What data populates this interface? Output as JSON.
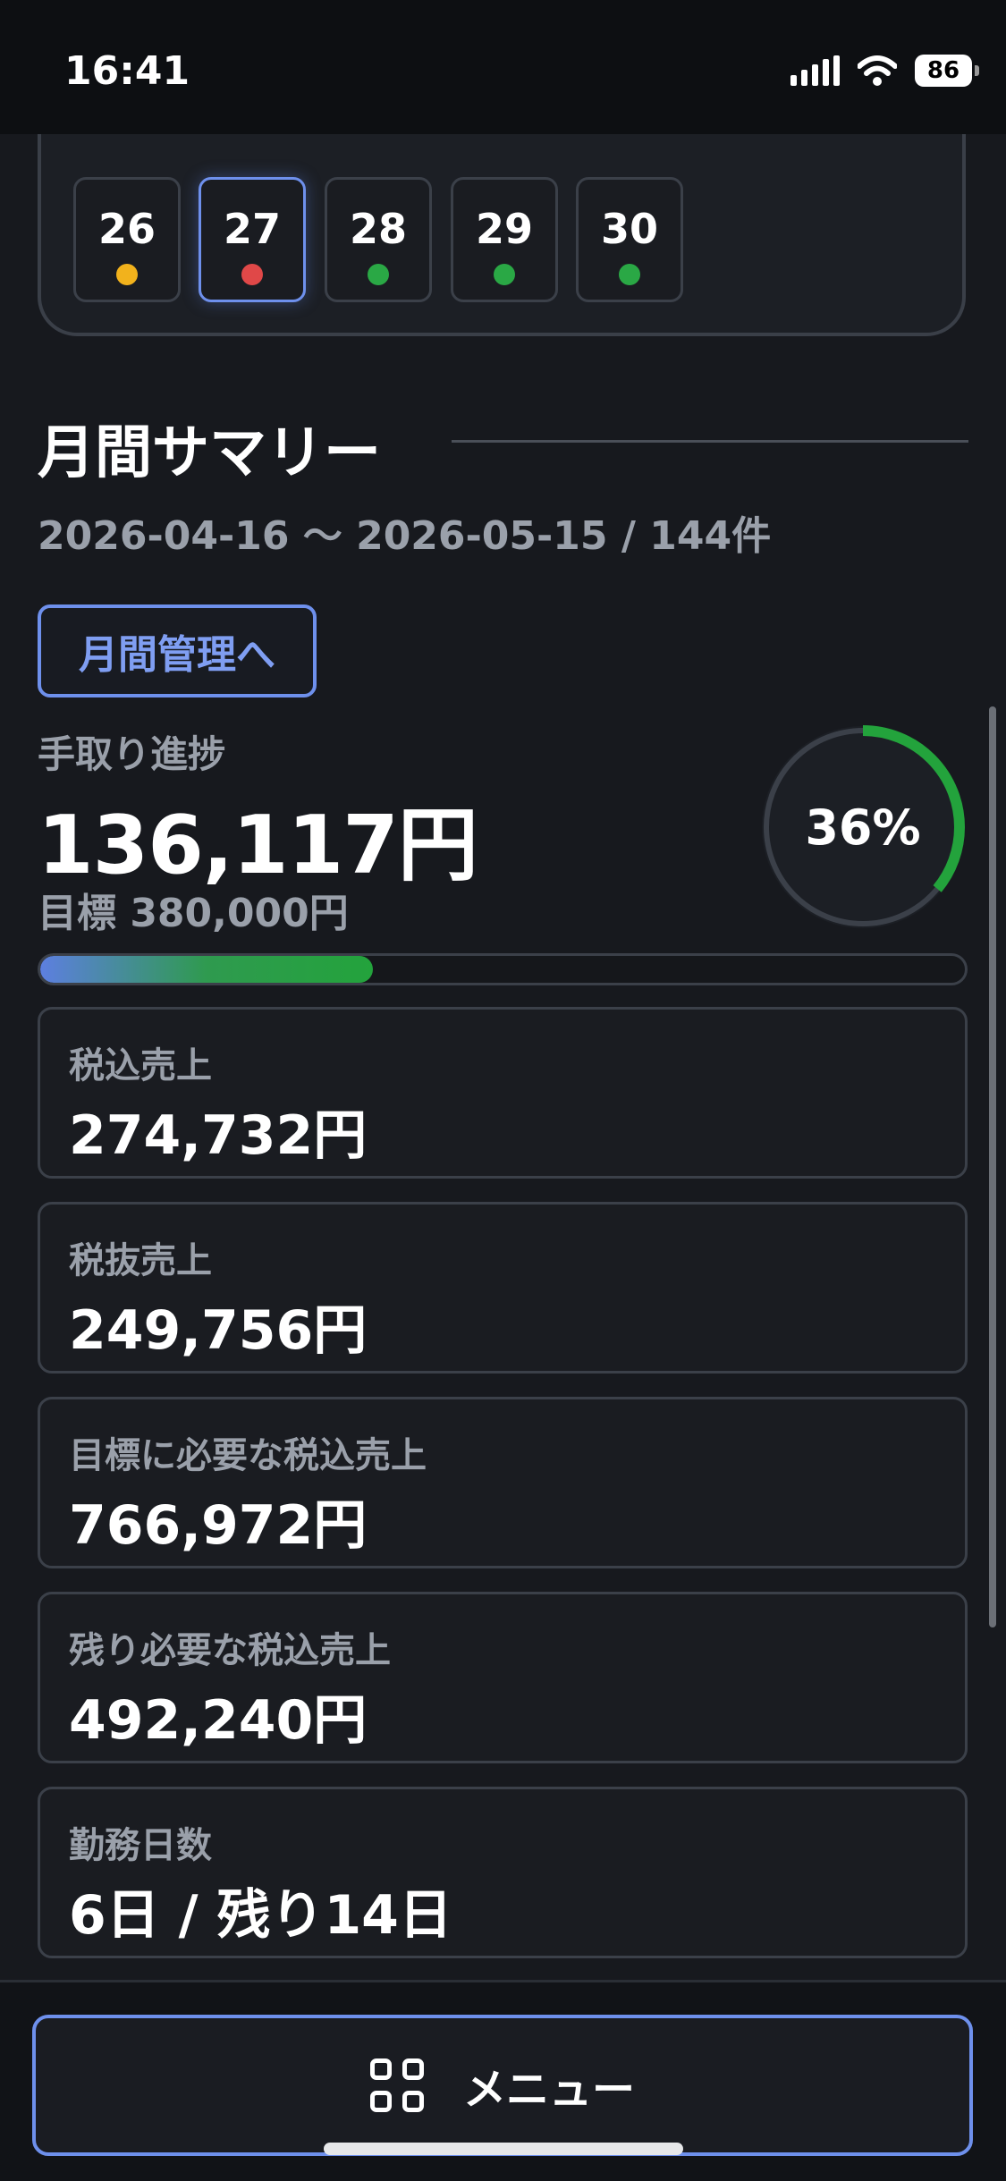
{
  "status_bar": {
    "time": "16:41",
    "battery": "86"
  },
  "calendar": {
    "partial_row_dots": [
      "#f2b21c",
      "#f2b21c",
      "#2aa845",
      "#e04848",
      "#2aa845",
      "#2aa845",
      "#2aa845"
    ],
    "days": [
      {
        "label": "26",
        "dot": "#f2b21c",
        "selected": false
      },
      {
        "label": "27",
        "dot": "#e04848",
        "selected": true
      },
      {
        "label": "28",
        "dot": "#2aa845",
        "selected": false
      },
      {
        "label": "29",
        "dot": "#2aa845",
        "selected": false
      },
      {
        "label": "30",
        "dot": "#2aa845",
        "selected": false
      }
    ]
  },
  "summary": {
    "title": "月間サマリー",
    "period": "2026-04-16 〜 2026-05-15 / 144件",
    "monthly_button": "月間管理へ",
    "progress_label": "手取り進捗",
    "take_home": "136,117円",
    "goal": "目標 380,000円",
    "percent_text": "36%",
    "percent": 0.36
  },
  "stats": [
    {
      "label": "税込売上",
      "value": "274,732円"
    },
    {
      "label": "税抜売上",
      "value": "249,756円"
    },
    {
      "label": "目標に必要な税込売上",
      "value": "766,972円"
    },
    {
      "label": "残り必要な税込売上",
      "value": "492,240円"
    },
    {
      "label": "勤務日数",
      "value": "6日 / 残り14日"
    }
  ],
  "bottom": {
    "menu_label": "メニュー"
  },
  "colors": {
    "accent": "#6e90ec",
    "green": "#23a33c",
    "background": "#17191e"
  }
}
